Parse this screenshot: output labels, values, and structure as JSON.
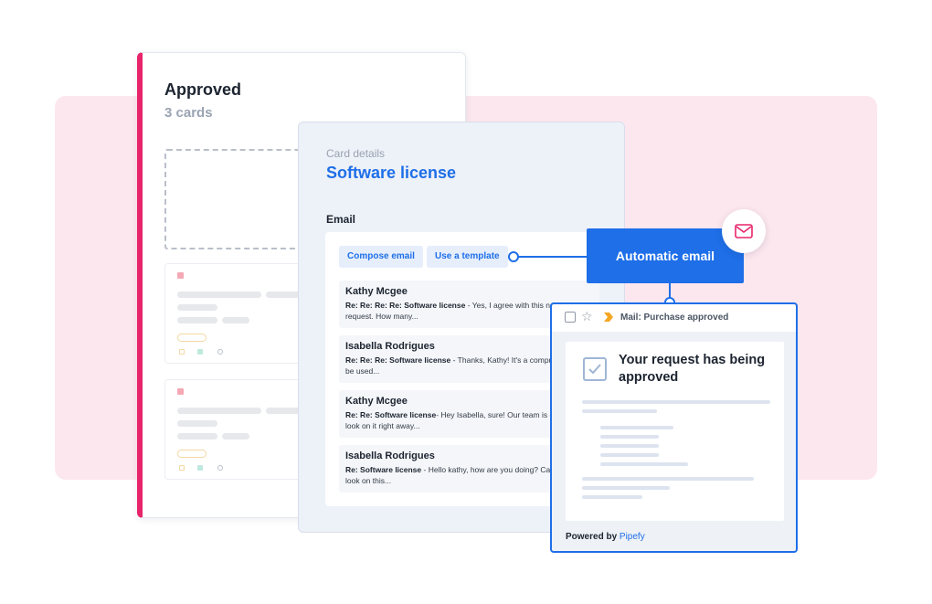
{
  "phase": {
    "title": "Approved",
    "count": "3 cards"
  },
  "details": {
    "kicker": "Card details",
    "title": "Software license",
    "section_label": "Email",
    "buttons": {
      "compose": "Compose email",
      "template": "Use a template"
    },
    "threads": [
      {
        "sender": "Kathy Mcgee",
        "subject": "Re: Re: Re: Re: Software license",
        "snippet": " - Yes, I agree with this new purchase request. How many..."
      },
      {
        "sender": "Isabella Rodrigues",
        "subject": "Re: Re: Re: Software license",
        "snippet": " - Thanks, Kathy! It's a computer that will be used..."
      },
      {
        "sender": "Kathy Mcgee",
        "subject": "Re: Re: Software license",
        "snippet": "- Hey Isabella, sure! Our team is going take a look on it right away..."
      },
      {
        "sender": "Isabella Rodrigues",
        "subject": "Re: Software license",
        "snippet": " - Hello kathy, how are you doing? Can you take a look on this..."
      }
    ]
  },
  "automation": {
    "label": "Automatic email"
  },
  "mail": {
    "subject": "Mail: Purchase approved",
    "heading": "Your request has being approved",
    "powered_prefix": "Powered by ",
    "powered_brand": "Pipefy"
  },
  "colors": {
    "accent": "#1e6fe8",
    "phase": "#e8246a",
    "background": "#fde7ee"
  }
}
